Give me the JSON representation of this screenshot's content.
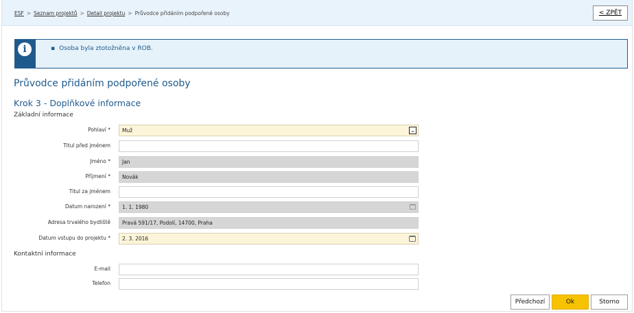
{
  "breadcrumb": {
    "items": [
      "ESF",
      "Seznam projektů",
      "Detail projektu"
    ],
    "current": "Průvodce přidáním podpořené osoby",
    "separator": ">"
  },
  "back_button": {
    "label": "< ZPĚT"
  },
  "alert": {
    "icon": "info-icon",
    "text": "Osoba byla ztotožněna v ROB."
  },
  "page_title": "Průvodce přidáním podpořené osoby",
  "step_title": "Krok 3 - Doplňkové informace",
  "sections": {
    "basic": "Základní informace",
    "contact": "Kontaktní informace"
  },
  "form": {
    "gender": {
      "label": "Pohlaví *",
      "value": "Muž"
    },
    "title_before": {
      "label": "Titul před jménem",
      "value": ""
    },
    "first_name": {
      "label": "Jméno *",
      "value": "Jan"
    },
    "last_name": {
      "label": "Příjmení *",
      "value": "Novák"
    },
    "title_after": {
      "label": "Titul za jménem",
      "value": ""
    },
    "birth_date": {
      "label": "Datum narození *",
      "value": "1. 1. 1980"
    },
    "address": {
      "label": "Adresa trvalého bydliště",
      "value": "Pravá 591/17, Podolí, 14700, Praha"
    },
    "entry_date": {
      "label": "Datum vstupu do projektu *",
      "value": "2. 3. 2016"
    },
    "email": {
      "label": "E-mail",
      "value": ""
    },
    "phone": {
      "label": "Telefon",
      "value": ""
    }
  },
  "buttons": {
    "previous": "Předchozí",
    "ok": "Ok",
    "cancel": "Storno"
  },
  "colors": {
    "accent": "#1f5a8c",
    "header_bg": "#e9f3fb",
    "required_bg": "#fdf5d9",
    "readonly_bg": "#d6d6d6",
    "primary_button": "#f7c200"
  }
}
